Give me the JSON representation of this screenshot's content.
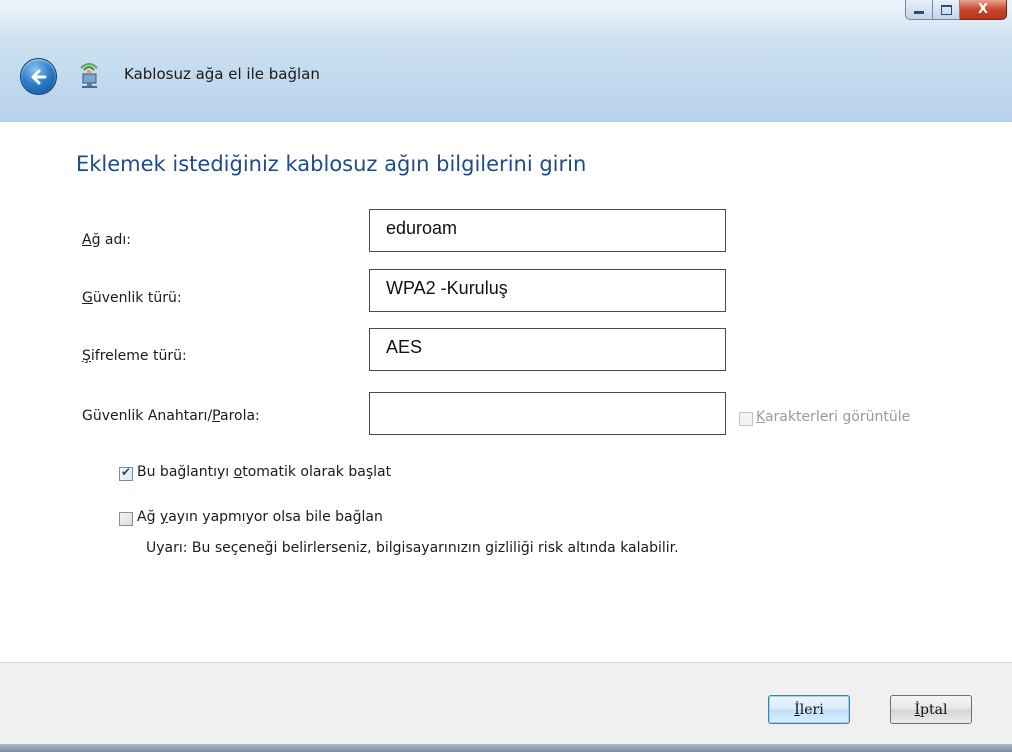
{
  "window": {
    "title": "Kablosuz ağa el ile bağlan",
    "close_glyph": "X"
  },
  "main": {
    "heading": "Eklemek istediğiniz kablosuz ağın bilgilerini girin",
    "network_name": {
      "label_accel": "A",
      "label_rest": "ğ adı:",
      "value": "eduroam"
    },
    "security_type": {
      "label_accel": "G",
      "label_rest": "üvenlik türü:",
      "value": "WPA2 -Kuruluş"
    },
    "encryption_type": {
      "label_accel": "Ş",
      "label_rest": "ifreleme türü:",
      "value": "AES"
    },
    "security_key": {
      "label_pre": "Güvenlik Anahtarı/",
      "label_accel": "P",
      "label_rest": "arola:",
      "value": ""
    },
    "show_characters": {
      "accel": "K",
      "rest": "arakterleri görüntüle",
      "checked": false,
      "enabled": false
    },
    "auto_start": {
      "pre": "Bu bağlantıyı ",
      "accel": "o",
      "rest": "tomatik olarak başlat",
      "checked": true
    },
    "connect_hidden": {
      "pre": "Ağ ",
      "accel": "y",
      "rest": "ayın yapmıyor olsa bile bağlan",
      "checked": false
    },
    "warning": "Uyarı: Bu seçeneği belirlerseniz, bilgisayarınızın gizliliği risk altında kalabilir."
  },
  "footer": {
    "next_accel": "İ",
    "next_rest": "leri",
    "cancel_accel": "İ",
    "cancel_rest": "ptal"
  },
  "icons": {
    "back": "back-arrow-icon",
    "app": "wireless-network-icon"
  }
}
